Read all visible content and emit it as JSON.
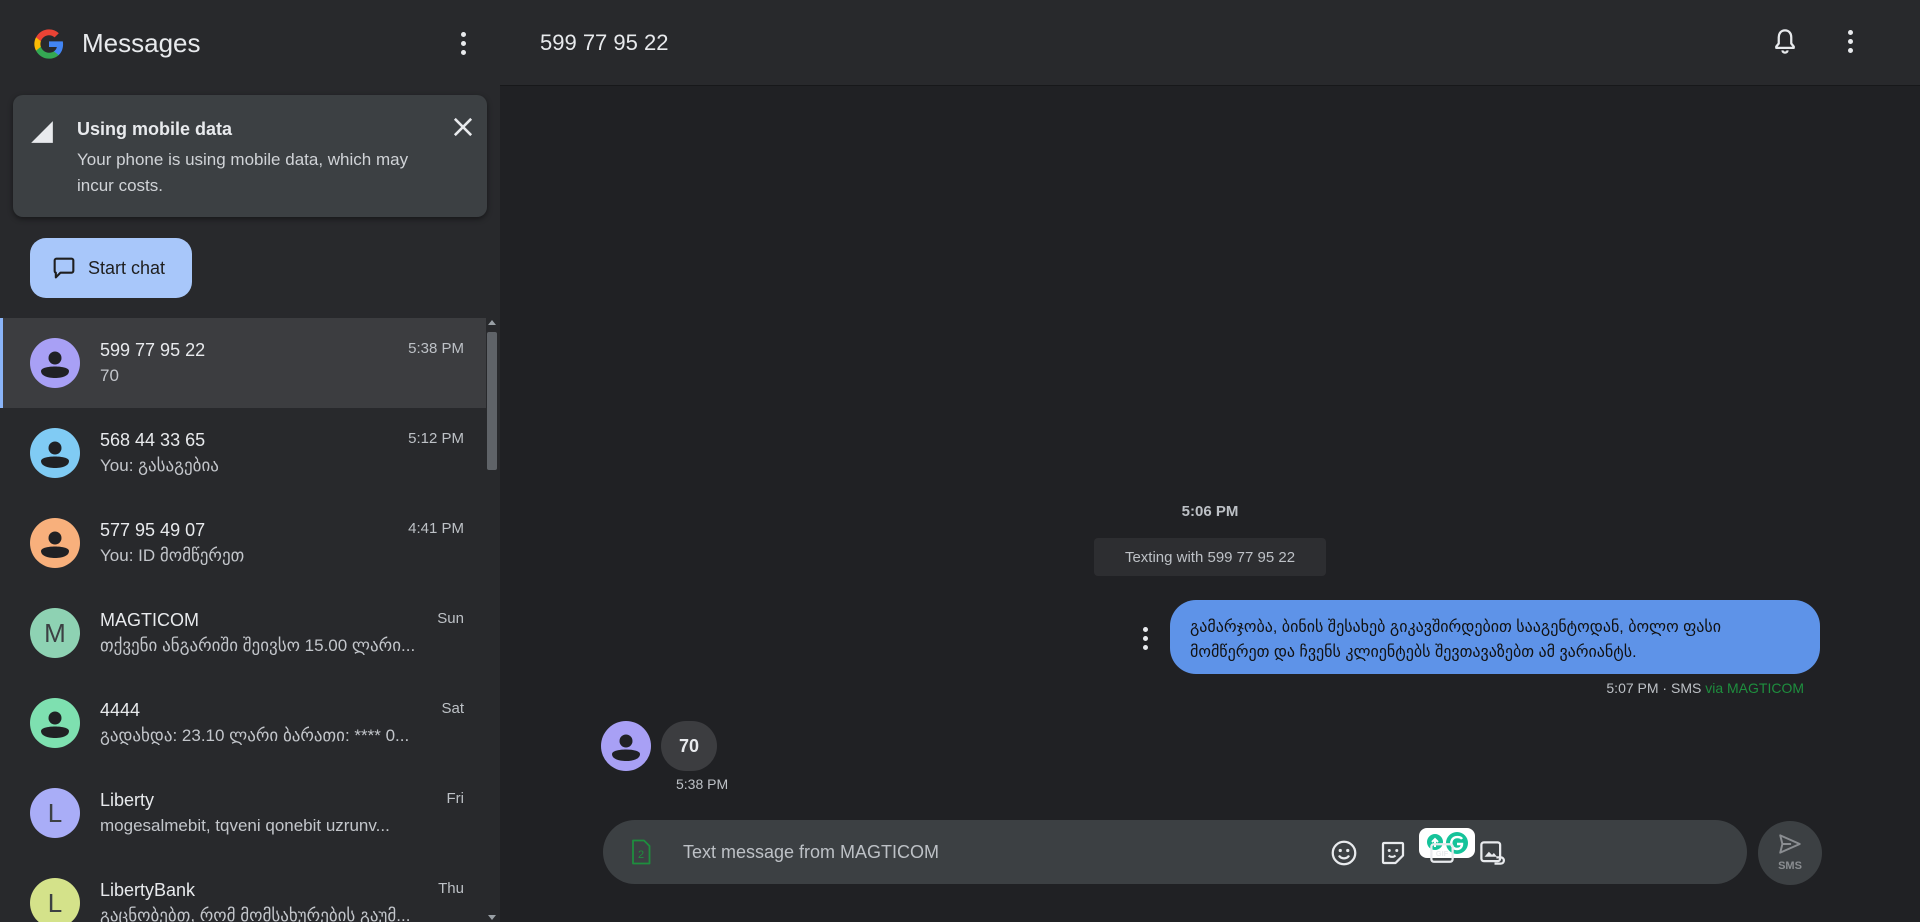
{
  "app": {
    "title": "Messages"
  },
  "banner": {
    "title": "Using mobile data",
    "body": "Your phone is using mobile data, which may incur costs."
  },
  "start_chat": {
    "label": "Start chat"
  },
  "conversations": [
    {
      "name": "599 77 95 22",
      "snippet": "70",
      "time": "5:38 PM",
      "avatar": "person",
      "color": "#a8a0f5",
      "active": true
    },
    {
      "name": "568 44 33 65",
      "snippet": "You: გასაგებია",
      "time": "5:12 PM",
      "avatar": "person",
      "color": "#80cbf4"
    },
    {
      "name": "577 95 49 07",
      "snippet": "You: ID მომწერეთ",
      "time": "4:41 PM",
      "avatar": "person",
      "color": "#f8b07c"
    },
    {
      "name": "MAGTICOM",
      "snippet": "თქვენი ანგარიში შეივსო 15.00 ლარი...",
      "time": "Sun",
      "avatar": "letter",
      "letter": "M",
      "color": "#8ed2b3"
    },
    {
      "name": "4444",
      "snippet": "გადახდა: 23.10 ლარი ბარათი: **** 0...",
      "time": "Sat",
      "avatar": "person",
      "color": "#7ee0b0"
    },
    {
      "name": "Liberty",
      "snippet": "mogesalmebit, tqveni qonebit uzrunv...",
      "time": "Fri",
      "avatar": "letter",
      "letter": "L",
      "color": "#a9adf7"
    },
    {
      "name": "LibertyBank",
      "snippet": "გაცნობებთ, რომ მომსახურების გაუმ...",
      "time": "Thu",
      "avatar": "letter",
      "letter": "L",
      "color": "#d4e28a"
    }
  ],
  "thread": {
    "title": "599 77 95 22",
    "day_time": "5:06 PM",
    "texting_with": "Texting with 599 77 95 22",
    "outgoing": {
      "text": "გამარჯობა, ბინის შესახებ გიკავშირდებით სააგენტოდან, ბოლო ფასი მომწერეთ და ჩვენს კლიენტებს შევთავაზებთ ამ ვარიანტს.",
      "time": "5:07 PM",
      "type": "SMS",
      "via": "via MAGTICOM"
    },
    "incoming": {
      "text": "70",
      "time": "5:38 PM"
    }
  },
  "composer": {
    "placeholder": "Text message from MAGTICOM",
    "sim": "2"
  },
  "send": {
    "label": "SMS"
  },
  "colors": {
    "accent": "#a8c7fa",
    "outgoing_bubble": "#5e93e8",
    "via": "#1e8e3e"
  }
}
